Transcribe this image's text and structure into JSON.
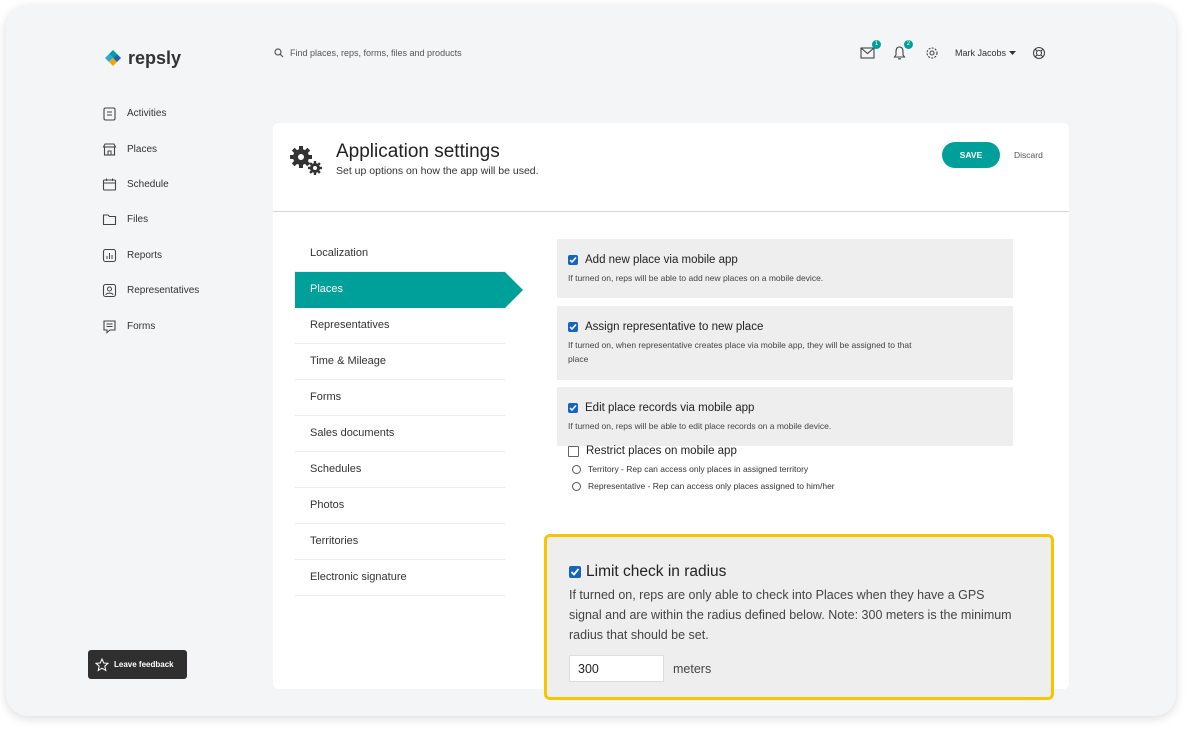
{
  "brand": {
    "name": "repsly"
  },
  "search": {
    "placeholder": "Find places, reps, forms, files and products"
  },
  "topbar": {
    "messages_count": "1",
    "notifications_count": "2",
    "user_name": "Mark Jacobs"
  },
  "sidebar": {
    "items": [
      {
        "label": "Activities",
        "icon": "clipboard-icon"
      },
      {
        "label": "Places",
        "icon": "store-icon"
      },
      {
        "label": "Schedule",
        "icon": "calendar-icon"
      },
      {
        "label": "Files",
        "icon": "folder-icon"
      },
      {
        "label": "Reports",
        "icon": "chart-icon"
      },
      {
        "label": "Representatives",
        "icon": "person-icon"
      },
      {
        "label": "Forms",
        "icon": "form-icon"
      }
    ],
    "feedback_label": "Leave feedback"
  },
  "settings": {
    "title": "Application settings",
    "subtitle": "Set up options on how the app will be used.",
    "save_label": "SAVE",
    "discard_label": "Discard",
    "nav": [
      "Localization",
      "Places",
      "Representatives",
      "Time & Mileage",
      "Forms",
      "Sales documents",
      "Schedules",
      "Photos",
      "Territories",
      "Electronic signature"
    ],
    "active_nav": "Places",
    "options": [
      {
        "title": "Add new place via mobile app",
        "desc": "If turned on, reps will be able to add new places on a mobile device.",
        "checked": true
      },
      {
        "title": "Assign representative to new place",
        "desc": "If turned on, when representative creates place via mobile app, they will be assigned to that place",
        "checked": true
      },
      {
        "title": "Edit place records via mobile app",
        "desc": "If turned on, reps will be able to edit place records on a mobile device.",
        "checked": true
      }
    ],
    "restrict": {
      "title": "Restrict places on mobile app",
      "checked": false,
      "radios": [
        "Territory - Rep can access only places in assigned territory",
        "Representative - Rep can access only places assigned to him/her"
      ]
    },
    "limit": {
      "title": "Limit check in radius",
      "checked": true,
      "desc": "If turned on, reps are only able to check into Places when they have a GPS signal and are within the radius defined below. Note: 300 meters is the minimum radius that should be set.",
      "value": "300",
      "unit": "meters"
    }
  },
  "colors": {
    "accent": "#00a09a",
    "highlight": "#f7c600",
    "checkbox": "#1565c0"
  }
}
